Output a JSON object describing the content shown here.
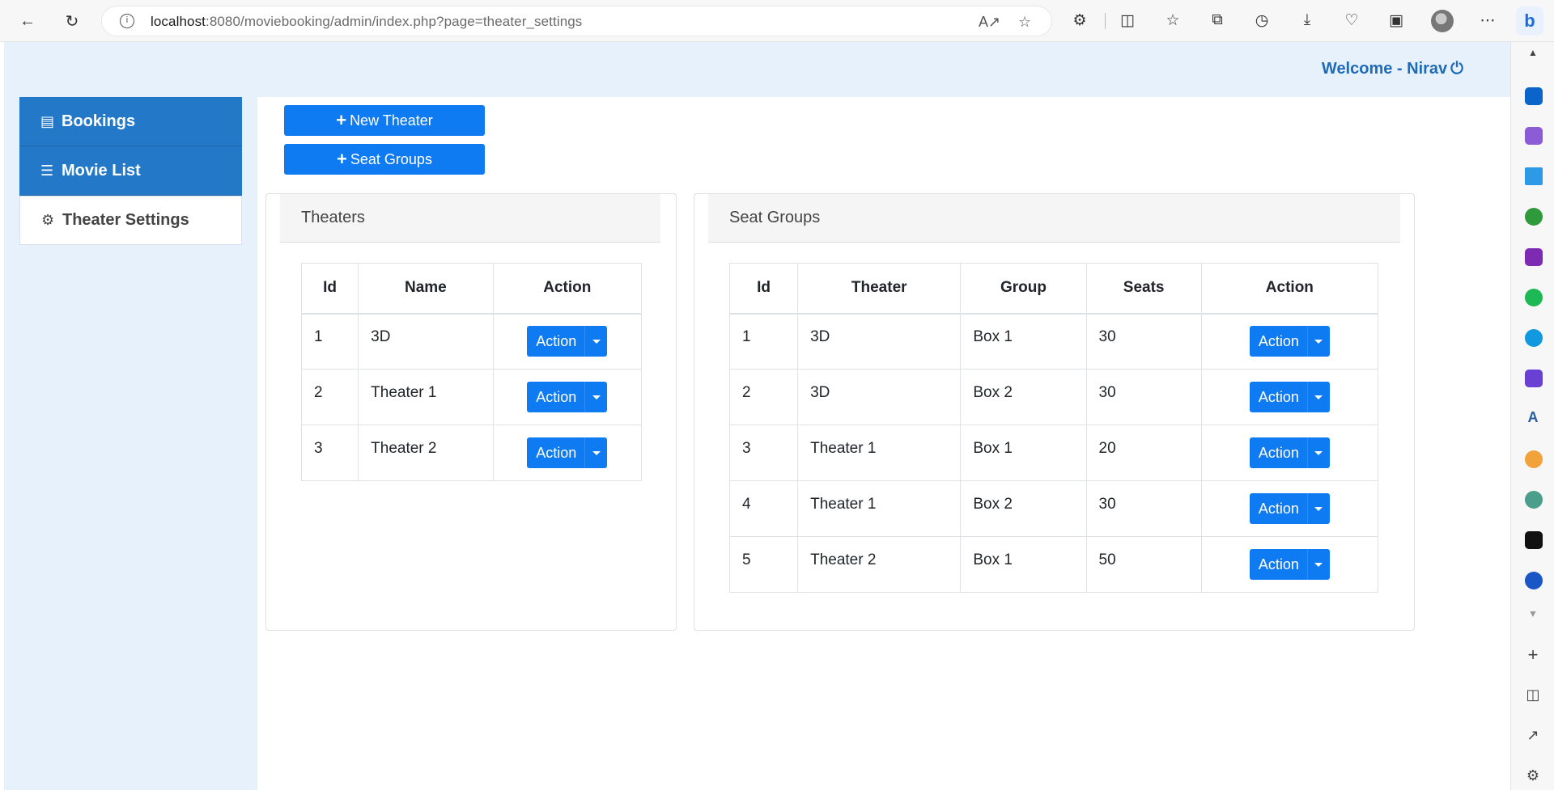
{
  "browser": {
    "url_host": "localhost",
    "url_rest": ":8080/moviebooking/admin/index.php?page=theater_settings"
  },
  "header": {
    "welcome": "Welcome - Nirav"
  },
  "sidebar": {
    "items": [
      {
        "label": "Bookings",
        "icon": "book-icon"
      },
      {
        "label": "Movie List",
        "icon": "list-icon"
      },
      {
        "label": "Theater Settings",
        "icon": "gear-icon"
      }
    ]
  },
  "toolbar": {
    "new_theater": "New Theater",
    "seat_groups": "Seat Groups"
  },
  "theaters": {
    "title": "Theaters",
    "columns": [
      "Id",
      "Name",
      "Action"
    ],
    "rows": [
      {
        "id": "1",
        "name": "3D",
        "action": "Action"
      },
      {
        "id": "2",
        "name": "Theater 1",
        "action": "Action"
      },
      {
        "id": "3",
        "name": "Theater 2",
        "action": "Action"
      }
    ]
  },
  "seat_groups": {
    "title": "Seat Groups",
    "columns": [
      "Id",
      "Theater",
      "Group",
      "Seats",
      "Action"
    ],
    "rows": [
      {
        "id": "1",
        "theater": "3D",
        "group": "Box 1",
        "seats": "30",
        "action": "Action"
      },
      {
        "id": "2",
        "theater": "3D",
        "group": "Box 2",
        "seats": "30",
        "action": "Action"
      },
      {
        "id": "3",
        "theater": "Theater 1",
        "group": "Box 1",
        "seats": "20",
        "action": "Action"
      },
      {
        "id": "4",
        "theater": "Theater 1",
        "group": "Box 2",
        "seats": "30",
        "action": "Action"
      },
      {
        "id": "5",
        "theater": "Theater 2",
        "group": "Box 1",
        "seats": "50",
        "action": "Action"
      }
    ]
  },
  "colors": {
    "primary": "#0f7bf2",
    "nav_blue": "#2478c8",
    "page_bg": "#e6f1fb",
    "welcome": "#1e6bb8"
  }
}
